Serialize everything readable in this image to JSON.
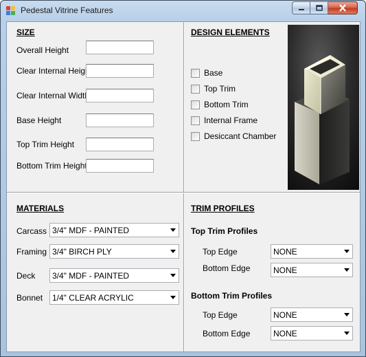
{
  "window": {
    "title": "Pedestal Vitrine Features"
  },
  "size": {
    "heading": "SIZE",
    "fields": [
      {
        "label": "Overall Height",
        "value": ""
      },
      {
        "label": "Clear Internal Height",
        "value": ""
      },
      {
        "label": "Clear Internal Width",
        "value": ""
      },
      {
        "label": "Base Height",
        "value": ""
      },
      {
        "label": "Top Trim Height",
        "value": ""
      },
      {
        "label": "Bottom Trim Height",
        "value": ""
      }
    ]
  },
  "design": {
    "heading": "DESIGN ELEMENTS",
    "checks": [
      {
        "label": "Base",
        "checked": false
      },
      {
        "label": "Top Trim",
        "checked": false
      },
      {
        "label": "Bottom Trim",
        "checked": false
      },
      {
        "label": "Internal Frame",
        "checked": false
      },
      {
        "label": "Desiccant Chamber",
        "checked": false
      }
    ]
  },
  "materials": {
    "heading": "MATERIALS",
    "rows": [
      {
        "label": "Carcass",
        "value": "3/4\" MDF - PAINTED"
      },
      {
        "label": "Framing",
        "value": "3/4\" BIRCH PLY"
      },
      {
        "label": "Deck",
        "value": "3/4\" MDF - PAINTED"
      },
      {
        "label": "Bonnet",
        "value": "1/4\" CLEAR ACRYLIC"
      }
    ]
  },
  "trim": {
    "heading": "TRIM PROFILES",
    "top_title": "Top Trim Profiles",
    "top_rows": [
      {
        "label": "Top Edge",
        "value": "NONE"
      },
      {
        "label": "Bottom Edge",
        "value": "NONE"
      }
    ],
    "bottom_title": "Bottom Trim Profiles",
    "bottom_rows": [
      {
        "label": "Top Edge",
        "value": "NONE"
      },
      {
        "label": "Bottom Edge",
        "value": "NONE"
      }
    ]
  },
  "icons": {
    "app": "app-icon",
    "minimize": "minimize-icon",
    "maximize": "maximize-icon",
    "close": "close-icon",
    "dropdown": "chevron-down-icon"
  }
}
